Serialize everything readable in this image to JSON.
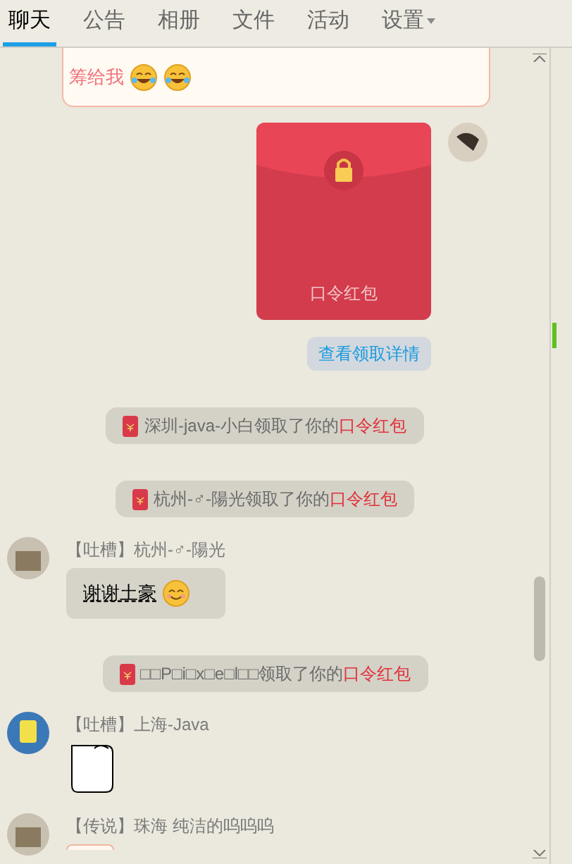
{
  "tabs": [
    {
      "label": "聊天",
      "selected": true
    },
    {
      "label": "公告",
      "selected": false
    },
    {
      "label": "相册",
      "selected": false
    },
    {
      "label": "文件",
      "selected": false
    },
    {
      "label": "活动",
      "selected": false
    },
    {
      "label": "设置",
      "selected": false,
      "dropdown": true
    }
  ],
  "top_message": {
    "text": "筹给我",
    "emojis": [
      {
        "kind": "laugh_cry"
      },
      {
        "kind": "laugh_cry"
      }
    ]
  },
  "red_packet": {
    "label": "口令红包",
    "details_button": "查看领取详情"
  },
  "messages": [
    {
      "kind": "notice",
      "text": "深圳-java-小白领取了你的",
      "highlight": "口令红包"
    },
    {
      "kind": "notice",
      "text": "杭州-♂-陽光领取了你的",
      "highlight": "口令红包"
    },
    {
      "kind": "chat",
      "tag": "【吐槽】",
      "sender": "杭州-♂-陽光",
      "text": "谢谢土豪",
      "emoji": true
    },
    {
      "kind": "notice",
      "text": "□□P□i□x□e□l□□领取了你的",
      "highlight": "口令红包"
    },
    {
      "kind": "chat",
      "tag": "【吐槽】",
      "sender": "上海-Java",
      "sticker": true
    },
    {
      "kind": "chat",
      "tag": "【传说】",
      "sender": "珠海 纯洁的呜呜呜",
      "partial": true
    }
  ]
}
